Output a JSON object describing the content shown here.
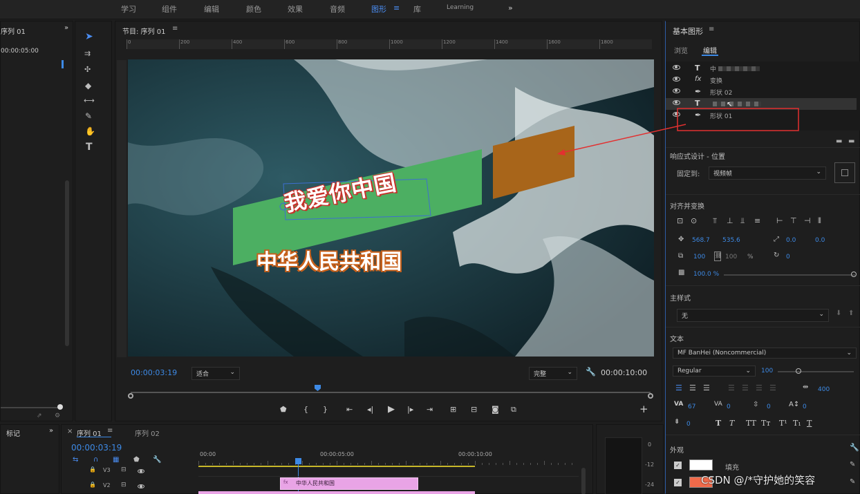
{
  "workspace_tabs": [
    "学习",
    "组件",
    "编辑",
    "颜色",
    "效果",
    "音频",
    "图形",
    "库",
    "Learning"
  ],
  "active_workspace_menu": "≡",
  "left_panel": {
    "title": "序列 01",
    "timecode": "00:00:05:00"
  },
  "program_monitor": {
    "title": "节目: 序列 01",
    "ruler_ticks": [
      "0",
      "200",
      "400",
      "600",
      "800",
      "1000",
      "1200",
      "1400",
      "1600",
      "1800"
    ],
    "current_time": "00:00:03:19",
    "fit": "适合",
    "quality": "完整",
    "duration": "00:00:10:00",
    "headline": "我爱你中国",
    "subline": "中华人民共和国"
  },
  "colors": {
    "green_shape": "#4caf62",
    "orange_shape": "#a8651a",
    "accent_blue": "#3d8ae6",
    "annotation_red": "#e23030"
  },
  "essential_graphics": {
    "title": "基本图形",
    "tabs": [
      "浏览",
      "编辑"
    ],
    "layers": [
      {
        "icon": "T",
        "label": "中"
      },
      {
        "icon": "fx",
        "label": "变换"
      },
      {
        "icon": "pen",
        "label": "形状 02"
      },
      {
        "icon": "T",
        "label": ""
      },
      {
        "icon": "pen",
        "label": "形状 01"
      }
    ],
    "responsive_title": "响应式设计 - 位置",
    "pin_label": "固定到:",
    "pin_value": "视频帧",
    "align_title": "对齐并变换",
    "pos_x": "568.7",
    "pos_y": "535.6",
    "anchor_x": "0.0",
    "anchor_y": "0.0",
    "scale_w": "100",
    "scale_h": "100",
    "scale_unit": "%",
    "rotation": "0",
    "opacity": "100.0 %",
    "master_style_title": "主样式",
    "master_style_value": "无",
    "text_title": "文本",
    "font": "MF BanHei (Noncommercial)",
    "font_style": "Regular",
    "font_size": "100",
    "tracking": "400",
    "kerning": "67",
    "va_value": "0",
    "leading": "0",
    "baseline": "0",
    "tsume": "0",
    "appearance_title": "外观",
    "fill_label": "填充"
  },
  "timeline": {
    "marker_panel": "标记",
    "tabs": [
      "序列 01",
      "序列 02"
    ],
    "timecode": "00:00:03:19",
    "ruler": [
      "00:00",
      "00:00:05:00",
      "00:00:10:00"
    ],
    "tracks": [
      "V3",
      "V2"
    ],
    "clip_label": "中华人民共和国",
    "meter_ticks": [
      "0",
      "-12",
      "-24"
    ]
  },
  "watermark": "CSDN @/*守护她的笑容"
}
